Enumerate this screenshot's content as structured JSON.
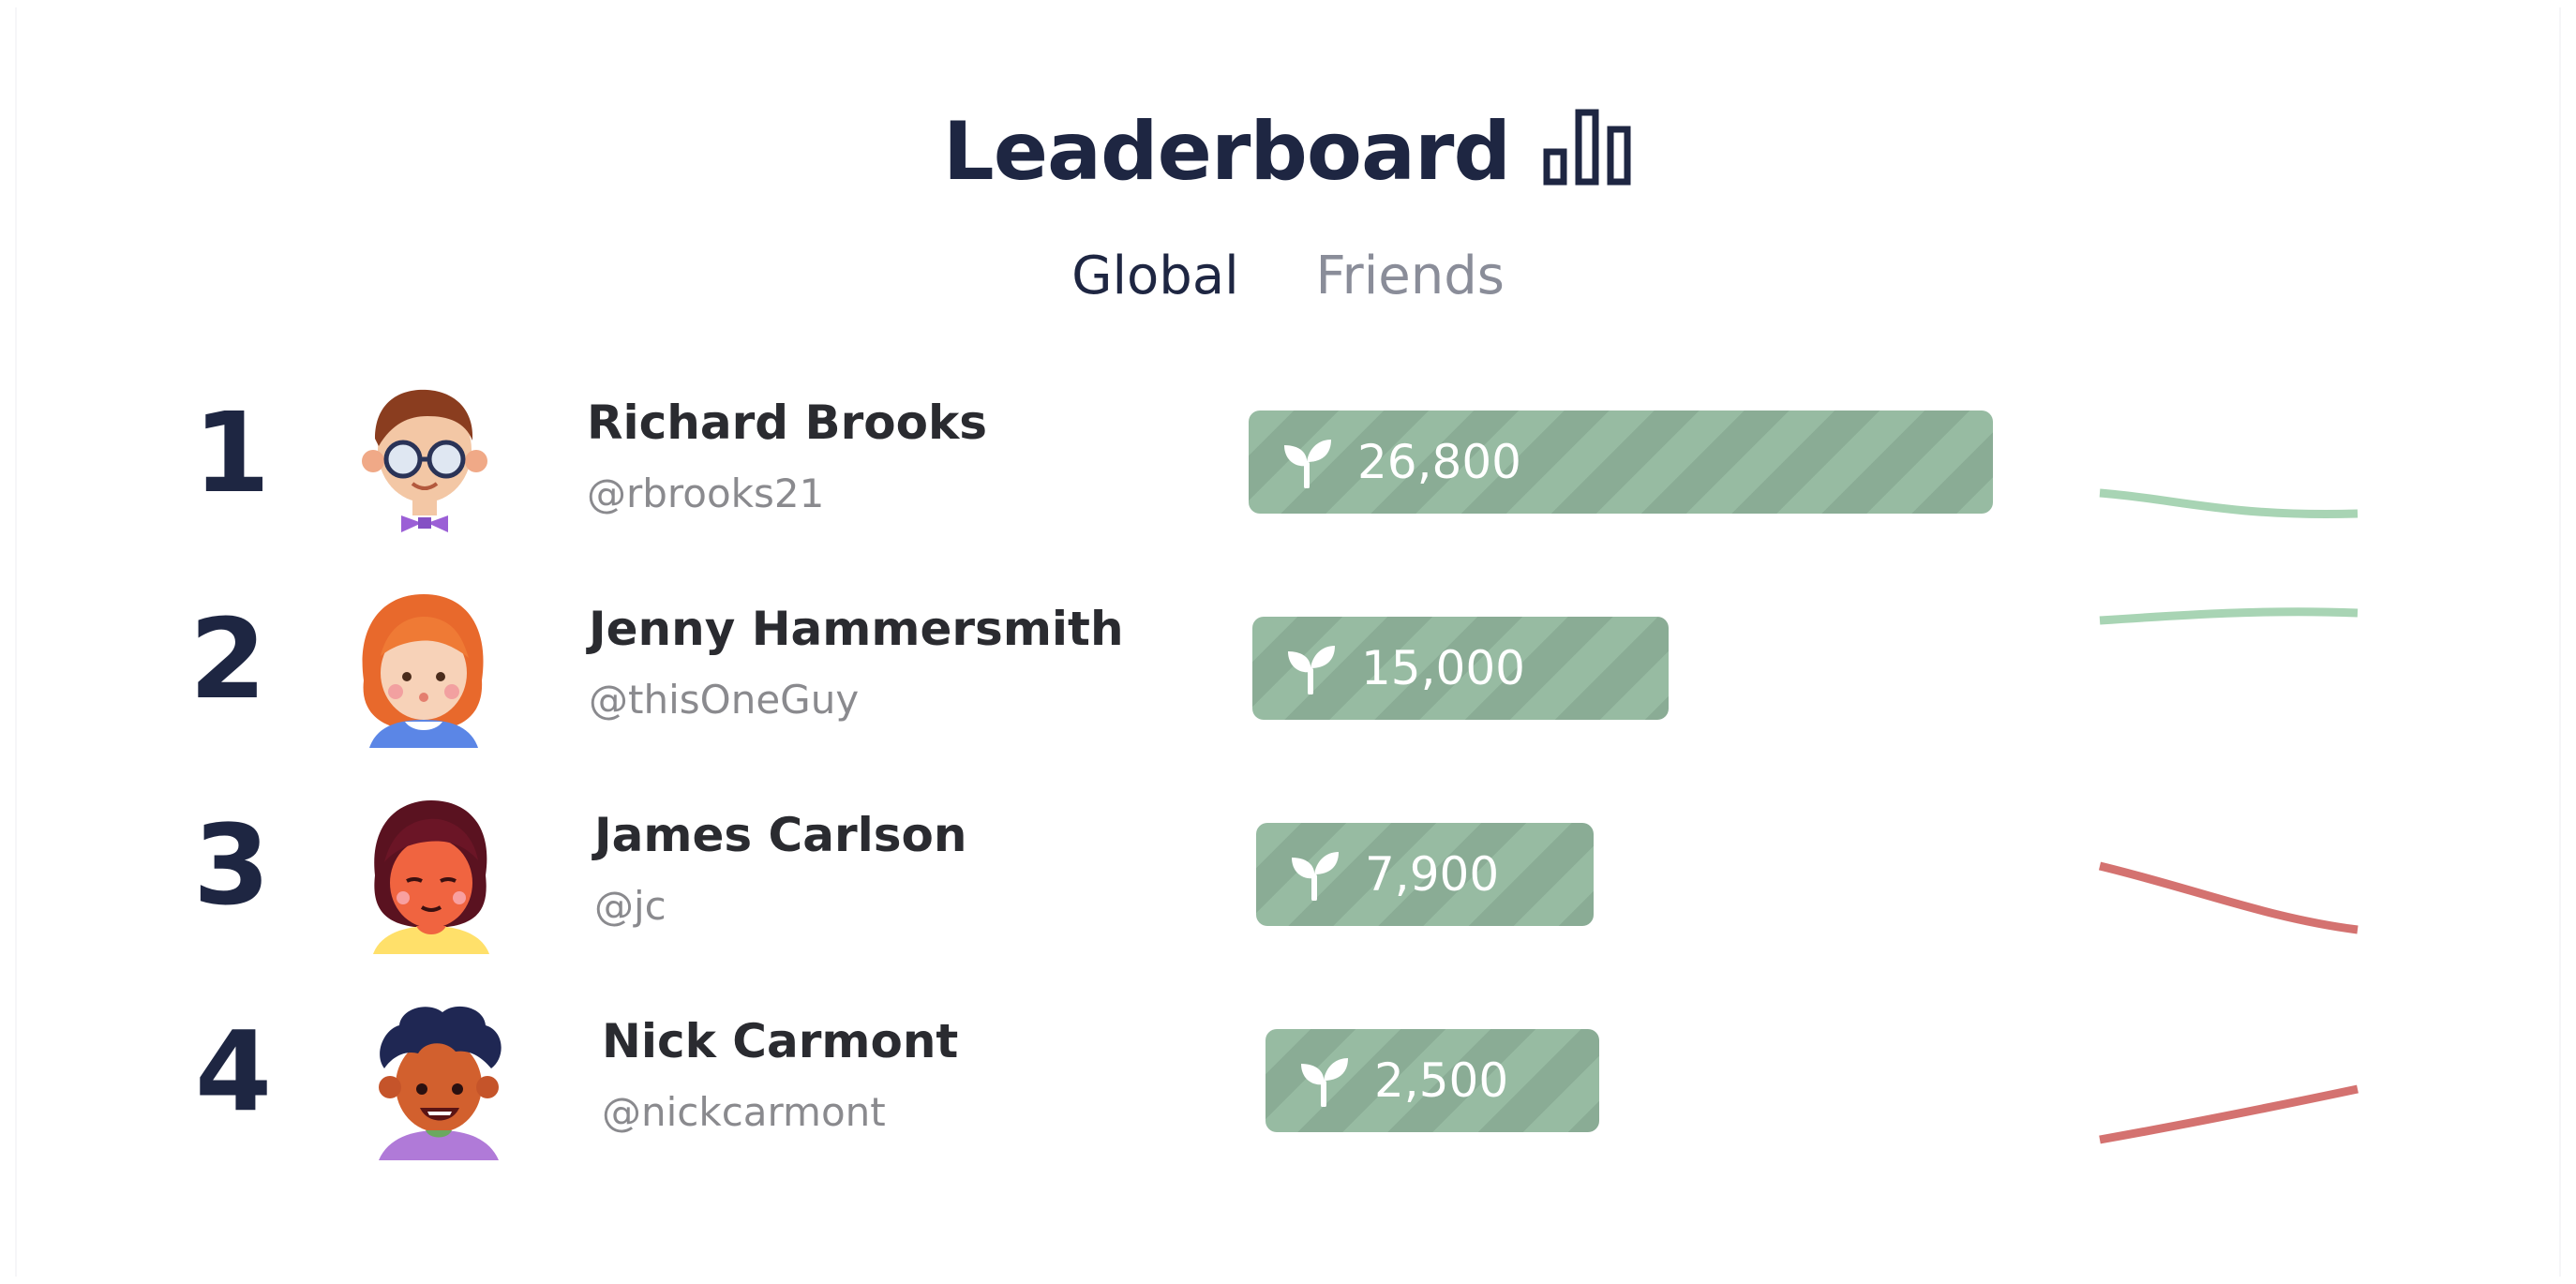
{
  "header": {
    "title": "Leaderboard",
    "title_icon": "bar-chart-icon",
    "text_color": "#1e2642"
  },
  "tabs": [
    {
      "label": "Global",
      "active": true
    },
    {
      "label": "Friends",
      "active": false
    }
  ],
  "score_icon": "sprout-icon",
  "colors": {
    "bar": "#94b8a0",
    "trend_up": "#a8d4b4",
    "trend_down": "#d47270"
  },
  "rows": [
    {
      "rank": "1",
      "name": "Richard Brooks",
      "handle": "@rbrooks21",
      "score": "26,800",
      "score_value": 26800,
      "avatar": "avatar-man-glasses-bowtie",
      "trend": "flat-green"
    },
    {
      "rank": "2",
      "name": "Jenny Hammersmith",
      "handle": "@thisOneGuy",
      "score": "15,000",
      "score_value": 15000,
      "avatar": "avatar-woman-orange-hair",
      "trend": "flat-green"
    },
    {
      "rank": "3",
      "name": "James Carlson",
      "handle": "@jc",
      "score": "7,900",
      "score_value": 7900,
      "avatar": "avatar-woman-dark-hair",
      "trend": "down-red"
    },
    {
      "rank": "4",
      "name": "Nick Carmont",
      "handle": "@nickcarmont",
      "score": "2,500",
      "score_value": 2500,
      "avatar": "avatar-man-curly-hair",
      "trend": "up-red"
    }
  ]
}
